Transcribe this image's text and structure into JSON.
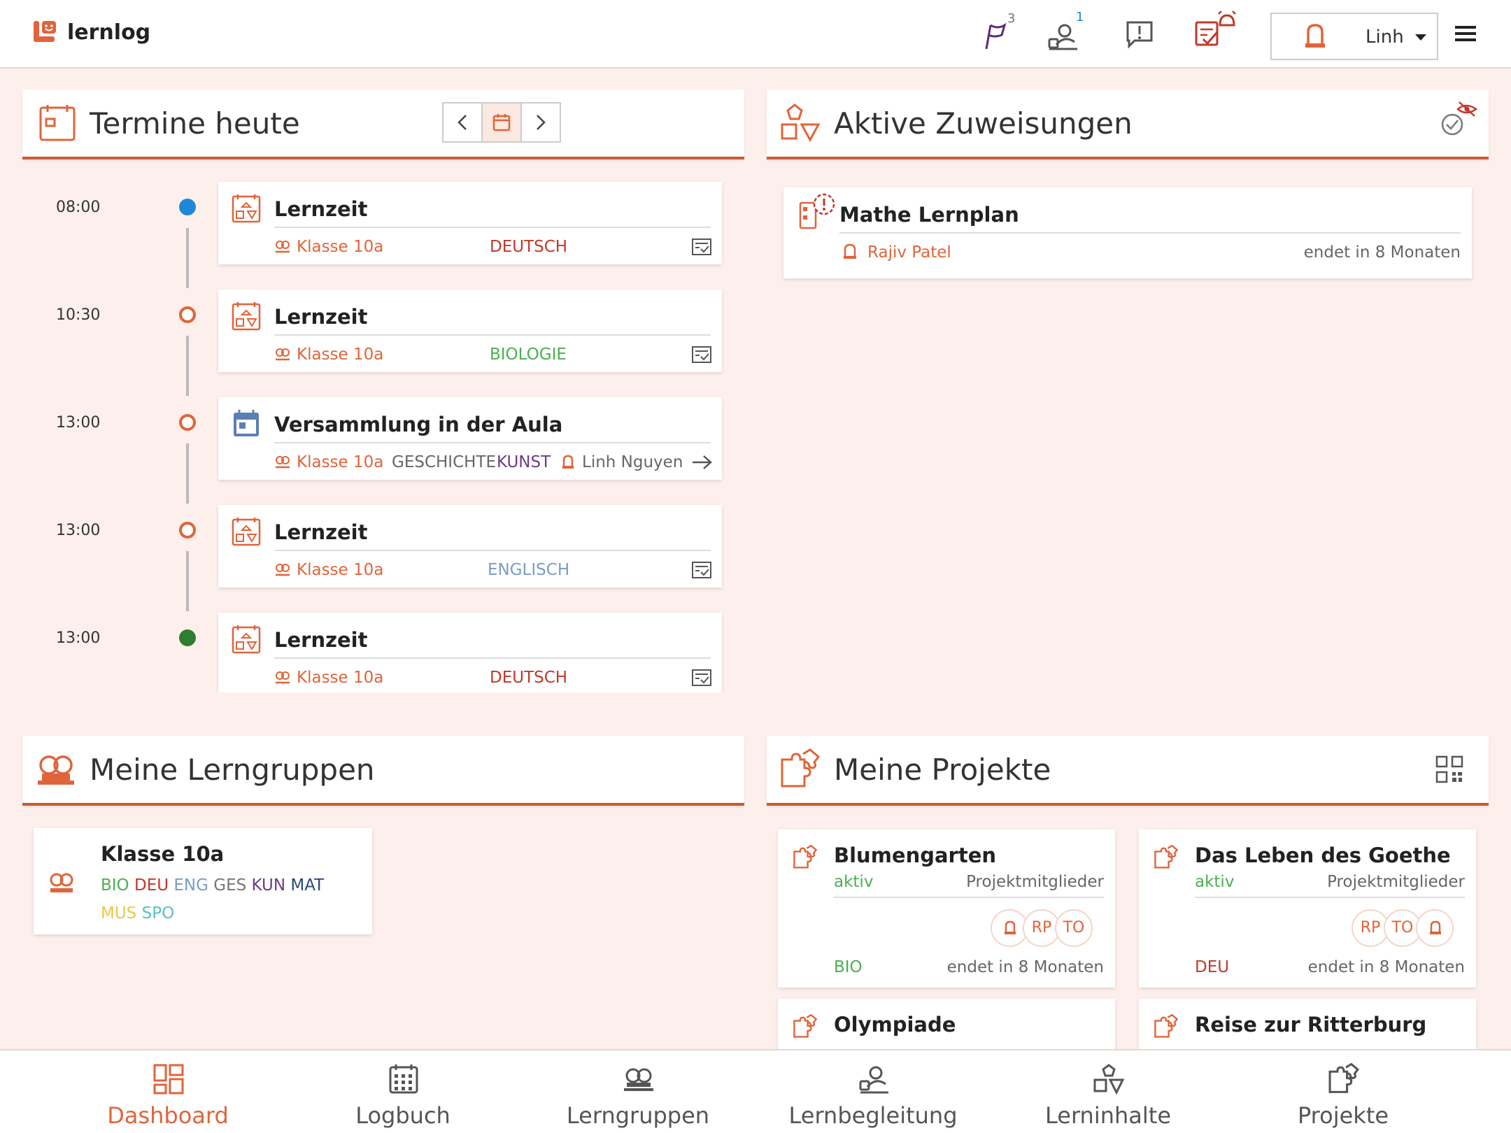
{
  "app": {
    "name": "lernlog"
  },
  "topbar": {
    "flag_count": "3",
    "support_count": "1",
    "user_name": "Linh"
  },
  "termine": {
    "title": "Termine heute",
    "events": [
      {
        "time": "08:00",
        "title": "Lernzeit",
        "group": "Klasse 10a",
        "subject": "DEUTSCH"
      },
      {
        "time": "10:30",
        "title": "Lernzeit",
        "group": "Klasse 10a",
        "subject": "BIOLOGIE"
      },
      {
        "time": "13:00",
        "title": "Versammlung in der Aula",
        "group": "Klasse 10a",
        "subject": "GESCHICHTE",
        "subject2": "KUNST",
        "person": "Linh Nguyen"
      },
      {
        "time": "13:00",
        "title": "Lernzeit",
        "group": "Klasse 10a",
        "subject": "ENGLISCH"
      },
      {
        "time": "13:00",
        "title": "Lernzeit",
        "group": "Klasse 10a",
        "subject": "DEUTSCH"
      }
    ]
  },
  "zuweisungen": {
    "title": "Aktive Zuweisungen",
    "items": [
      {
        "title": "Mathe Lernplan",
        "person": "Rajiv Patel",
        "deadline": "endet in 8 Monaten"
      }
    ]
  },
  "lerngruppen": {
    "title": "Meine Lerngruppen",
    "groups": [
      {
        "name": "Klasse 10a",
        "subjects": [
          "BIO",
          "DEU",
          "ENG",
          "GES",
          "KUN",
          "MAT",
          "MUS",
          "SPO"
        ]
      }
    ]
  },
  "projekte": {
    "title": "Meine Projekte",
    "items": [
      {
        "title": "Blumengarten",
        "status": "aktiv",
        "members_label": "Projektmitglieder",
        "members": [
          "RP",
          "TO"
        ],
        "subject": "BIO",
        "deadline": "endet in 8 Monaten"
      },
      {
        "title": "Das Leben des Goethe",
        "status": "aktiv",
        "members_label": "Projektmitglieder",
        "members": [
          "RP",
          "TO"
        ],
        "subject": "DEU",
        "deadline": "endet in 8 Monaten"
      },
      {
        "title": "Olympiade"
      },
      {
        "title": "Reise zur Ritterburg"
      }
    ]
  },
  "nav": {
    "items": [
      "Dashboard",
      "Logbuch",
      "Lerngruppen",
      "Lernbegleitung",
      "Lerninhalte",
      "Projekte"
    ]
  },
  "colors": {
    "accent": "#e0643a",
    "panel_border": "#c85a32",
    "deutsch": "#c0392b",
    "biologie": "#4caf50",
    "englisch": "#7a9cc6",
    "kunst": "#6a3d8a",
    "dot_blue": "#1e88d6",
    "dot_green": "#2e7d32"
  }
}
